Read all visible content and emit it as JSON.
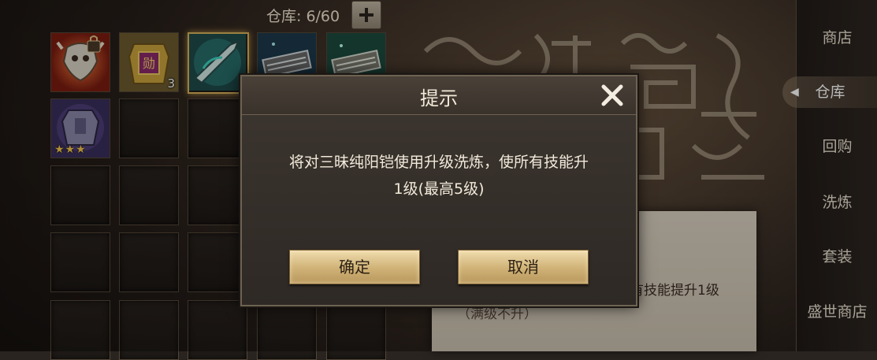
{
  "topbar": {
    "storage_label": "仓库: 6/60",
    "add_icon": "plus-icon"
  },
  "inventory": {
    "items": [
      {
        "name": "locked-demon-armor",
        "icon": "demon-armor-icon",
        "locked": true
      },
      {
        "name": "medal-bag",
        "icon": "medal-bag-icon",
        "count": "3"
      },
      {
        "name": "teal-blade",
        "icon": "blade-icon",
        "selected": true
      },
      {
        "name": "scroll-1",
        "icon": "scroll-icon"
      },
      {
        "name": "scroll-2",
        "icon": "scroll-icon"
      },
      {
        "name": "sanmei-armor",
        "icon": "armor-icon",
        "stars": "★★★"
      }
    ]
  },
  "nav": {
    "items": [
      {
        "label": "商店"
      },
      {
        "label": "仓库",
        "active": true
      },
      {
        "label": "回购"
      },
      {
        "label": "洗炼"
      },
      {
        "label": "套装"
      },
      {
        "label": "盛世商店"
      }
    ]
  },
  "background_panel": {
    "line1": "有技能提升1级",
    "line2": "（满级不升）"
  },
  "dialog": {
    "title": "提示",
    "message_line1": "将对三昧纯阳铠使用升级洗炼，使所有技能升",
    "message_line2": "1级(最高5级)",
    "confirm_label": "确定",
    "cancel_label": "取消",
    "close_icon": "close-icon"
  },
  "colors": {
    "button_gold": "#d2b57a",
    "selected_border": "#d8b25a",
    "star_gold": "#f4c64a"
  }
}
